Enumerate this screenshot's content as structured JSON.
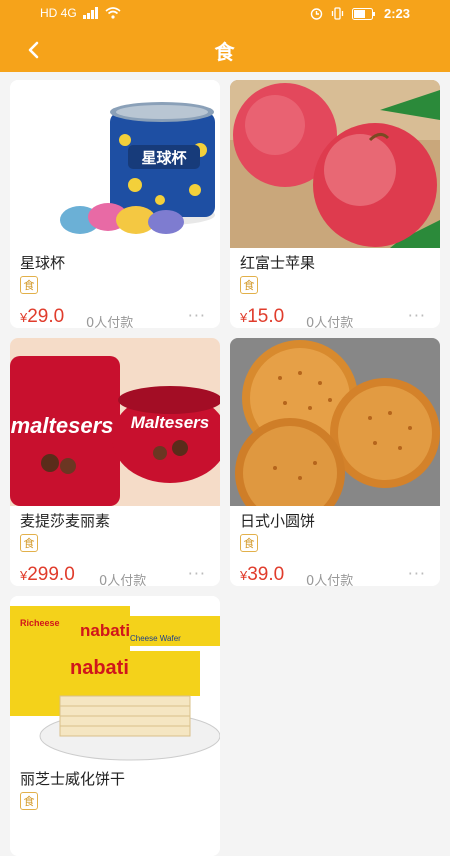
{
  "status_bar": {
    "network": "HD 4G",
    "time": "2:23"
  },
  "header": {
    "title": "食"
  },
  "products": [
    {
      "name": "星球杯",
      "tag": "食",
      "currency": "¥",
      "price": "29.0",
      "buyers": "0人付款",
      "image": "chocolate-cup-snack"
    },
    {
      "name": "红富士苹果",
      "tag": "食",
      "currency": "¥",
      "price": "15.0",
      "buyers": "0人付款",
      "image": "red-apples"
    },
    {
      "name": "麦提莎麦丽素",
      "tag": "食",
      "currency": "¥",
      "price": "299.0",
      "buyers": "0人付款",
      "image": "maltesers-tub"
    },
    {
      "name": "日式小圆饼",
      "tag": "食",
      "currency": "¥",
      "price": "39.0",
      "buyers": "0人付款",
      "image": "round-crackers"
    },
    {
      "name": "丽芝士威化饼干",
      "tag": "食",
      "image": "nabati-wafers"
    }
  ],
  "image_text": {
    "qiuqiu_label": "星球杯",
    "maltesers_left": "maltesers",
    "maltesers_right": "Maltesers",
    "nabati_brand": "nabati",
    "nabati_sub": "Cheese Wafer",
    "richeese": "Richeese"
  },
  "colors": {
    "accent": "#f6a31a",
    "price": "#e03c2c",
    "tag_border": "#e2b04a"
  }
}
